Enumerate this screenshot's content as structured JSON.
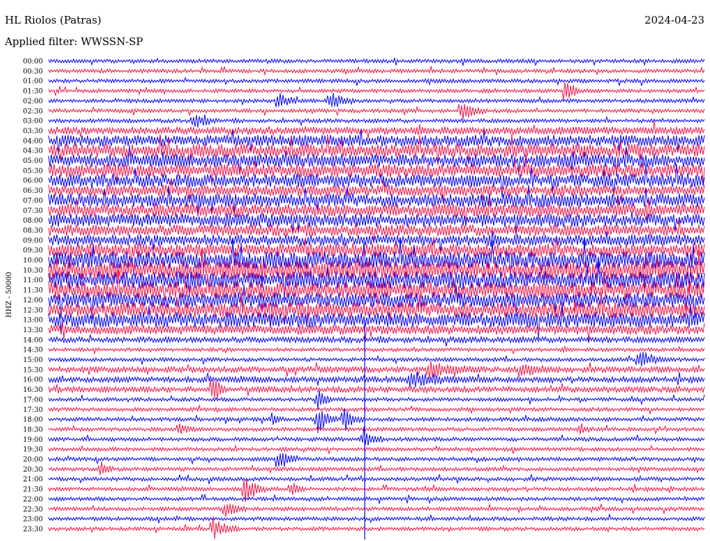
{
  "header": {
    "station": "HL Riolos (Patras)",
    "date": "2024-04-23",
    "filter_label": "Applied filter: WWSSN-SP"
  },
  "colors": {
    "trace_a": "#0000ee",
    "trace_b": "#ee1144"
  },
  "chart_data": {
    "type": "line",
    "title": "HL Riolos (Patras)",
    "subtitle": "Applied filter: WWSSN-SP",
    "ylabel": "HHZ - 50000",
    "tick_labels": [
      "00:00",
      "00:30",
      "01:00",
      "01:30",
      "02:00",
      "02:30",
      "03:00",
      "03:30",
      "04:00",
      "04:30",
      "05:00",
      "05:30",
      "06:00",
      "06:30",
      "07:00",
      "07:30",
      "08:00",
      "08:30",
      "09:00",
      "09:30",
      "10:00",
      "10:30",
      "11:00",
      "11:30",
      "12:00",
      "12:30",
      "13:00",
      "13:30",
      "14:00",
      "14:30",
      "15:00",
      "15:30",
      "16:00",
      "16:30",
      "17:00",
      "17:30",
      "18:00",
      "18:30",
      "19:00",
      "19:30",
      "20:00",
      "20:30",
      "21:00",
      "21:30",
      "22:00",
      "22:30",
      "23:00",
      "23:30"
    ],
    "series": [
      {
        "color": "#0000ee",
        "noise": 2
      },
      {
        "color": "#ee1144",
        "noise": 2
      },
      {
        "color": "#0000ee",
        "noise": 2
      },
      {
        "color": "#ee1144",
        "noise": 2,
        "events": [
          {
            "x": 0.79,
            "a": 16,
            "w": 0.02
          }
        ]
      },
      {
        "color": "#0000ee",
        "noise": 2,
        "events": [
          {
            "x": 0.35,
            "a": 10,
            "w": 0.03
          },
          {
            "x": 0.43,
            "a": 8,
            "w": 0.04
          }
        ]
      },
      {
        "color": "#ee1144",
        "noise": 2,
        "events": [
          {
            "x": 0.63,
            "a": 9,
            "w": 0.04
          }
        ]
      },
      {
        "color": "#0000ee",
        "noise": 2,
        "events": [
          {
            "x": 0.22,
            "a": 8,
            "w": 0.04
          }
        ]
      },
      {
        "color": "#ee1144",
        "noise": 4
      },
      {
        "color": "#0000ee",
        "noise": 6
      },
      {
        "color": "#ee1144",
        "noise": 7
      },
      {
        "color": "#0000ee",
        "noise": 7
      },
      {
        "color": "#ee1144",
        "noise": 7
      },
      {
        "color": "#0000ee",
        "noise": 7
      },
      {
        "color": "#ee1144",
        "noise": 6
      },
      {
        "color": "#0000ee",
        "noise": 7
      },
      {
        "color": "#ee1144",
        "noise": 7
      },
      {
        "color": "#0000ee",
        "noise": 7
      },
      {
        "color": "#ee1144",
        "noise": 6
      },
      {
        "color": "#0000ee",
        "noise": 6
      },
      {
        "color": "#ee1144",
        "noise": 7
      },
      {
        "color": "#0000ee",
        "noise": 9
      },
      {
        "color": "#ee1144",
        "noise": 10
      },
      {
        "color": "#0000ee",
        "noise": 9
      },
      {
        "color": "#ee1144",
        "noise": 9
      },
      {
        "color": "#0000ee",
        "noise": 8
      },
      {
        "color": "#ee1144",
        "noise": 8
      },
      {
        "color": "#0000ee",
        "noise": 8
      },
      {
        "color": "#ee1144",
        "noise": 5
      },
      {
        "color": "#0000ee",
        "noise": 3
      },
      {
        "color": "#ee1144",
        "noise": 2
      },
      {
        "color": "#0000ee",
        "noise": 2,
        "events": [
          {
            "x": 0.9,
            "a": 8,
            "w": 0.05
          }
        ]
      },
      {
        "color": "#ee1144",
        "noise": 3,
        "events": [
          {
            "x": 0.58,
            "a": 8,
            "w": 0.08
          },
          {
            "x": 0.72,
            "a": 6,
            "w": 0.06
          }
        ]
      },
      {
        "color": "#0000ee",
        "noise": 3,
        "events": [
          {
            "x": 0.55,
            "a": 7,
            "w": 0.1
          }
        ]
      },
      {
        "color": "#ee1144",
        "noise": 3,
        "events": [
          {
            "x": 0.25,
            "a": 18,
            "w": 0.02
          }
        ]
      },
      {
        "color": "#0000ee",
        "noise": 2,
        "events": [
          {
            "x": 0.41,
            "a": 14,
            "w": 0.02
          }
        ]
      },
      {
        "color": "#ee1144",
        "noise": 2
      },
      {
        "color": "#0000ee",
        "noise": 2,
        "events": [
          {
            "x": 0.41,
            "a": 16,
            "w": 0.03
          },
          {
            "x": 0.45,
            "a": 12,
            "w": 0.03
          },
          {
            "x": 0.34,
            "a": 6,
            "w": 0.02
          }
        ]
      },
      {
        "color": "#ee1144",
        "noise": 2,
        "events": [
          {
            "x": 0.2,
            "a": 5,
            "w": 0.03
          },
          {
            "x": 0.81,
            "a": 6,
            "w": 0.02
          }
        ]
      },
      {
        "color": "#0000ee",
        "noise": 2,
        "events": [
          {
            "x": 0.48,
            "a": 12,
            "w": 0.03
          }
        ]
      },
      {
        "color": "#ee1144",
        "noise": 2
      },
      {
        "color": "#0000ee",
        "noise": 2,
        "events": [
          {
            "x": 0.35,
            "a": 14,
            "w": 0.03
          }
        ]
      },
      {
        "color": "#ee1144",
        "noise": 2,
        "events": [
          {
            "x": 0.08,
            "a": 9,
            "w": 0.02
          }
        ]
      },
      {
        "color": "#0000ee",
        "noise": 2
      },
      {
        "color": "#ee1144",
        "noise": 2,
        "events": [
          {
            "x": 0.3,
            "a": 14,
            "w": 0.03
          },
          {
            "x": 0.37,
            "a": 8,
            "w": 0.02
          }
        ]
      },
      {
        "color": "#0000ee",
        "noise": 2
      },
      {
        "color": "#ee1144",
        "noise": 2,
        "events": [
          {
            "x": 0.27,
            "a": 10,
            "w": 0.03
          }
        ]
      },
      {
        "color": "#0000ee",
        "noise": 2
      },
      {
        "color": "#ee1144",
        "noise": 2,
        "events": [
          {
            "x": 0.25,
            "a": 12,
            "w": 0.04
          }
        ]
      }
    ]
  }
}
